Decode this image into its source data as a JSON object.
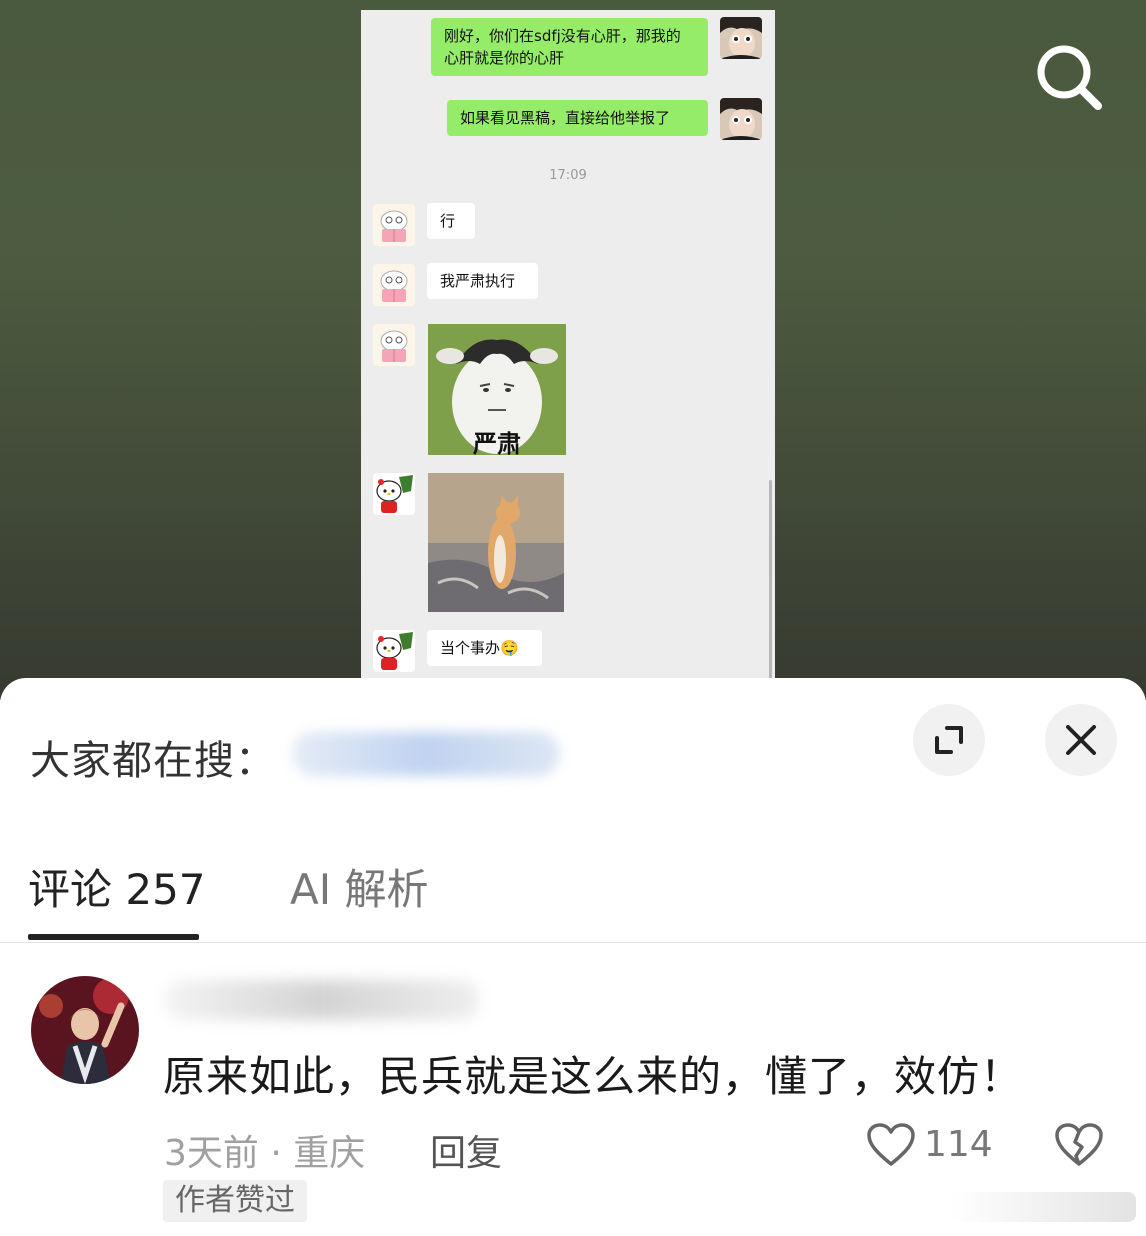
{
  "chat": {
    "messages": [
      {
        "side": "right",
        "text": "刚好，你们在sdfj没有心肝，那我的心肝就是你的心肝"
      },
      {
        "side": "right",
        "text": "如果看见黑稿，直接给他举报了"
      },
      {
        "side": "left",
        "text": "行"
      },
      {
        "side": "left",
        "text": "我严肃执行"
      },
      {
        "side": "left",
        "text": "当个事办🤤"
      }
    ],
    "timestamp": "17:09",
    "sticker_text": "严肃"
  },
  "search": {
    "icon": "search-icon"
  },
  "sheet": {
    "hot_search_label": "大家都在搜：",
    "tabs": [
      {
        "label": "评论 257",
        "active": true
      },
      {
        "label": "AI 解析",
        "active": false
      }
    ]
  },
  "comment": {
    "text": "原来如此，民兵就是这么来的，懂了，效仿！",
    "meta": "3天前 · 重庆",
    "reply_label": "回复",
    "like_count": "114",
    "author_badge": "作者赞过"
  },
  "colors": {
    "bubble_green": "#95ec69",
    "chat_bg": "#ededed",
    "top_bg": "#4a5a3e"
  }
}
